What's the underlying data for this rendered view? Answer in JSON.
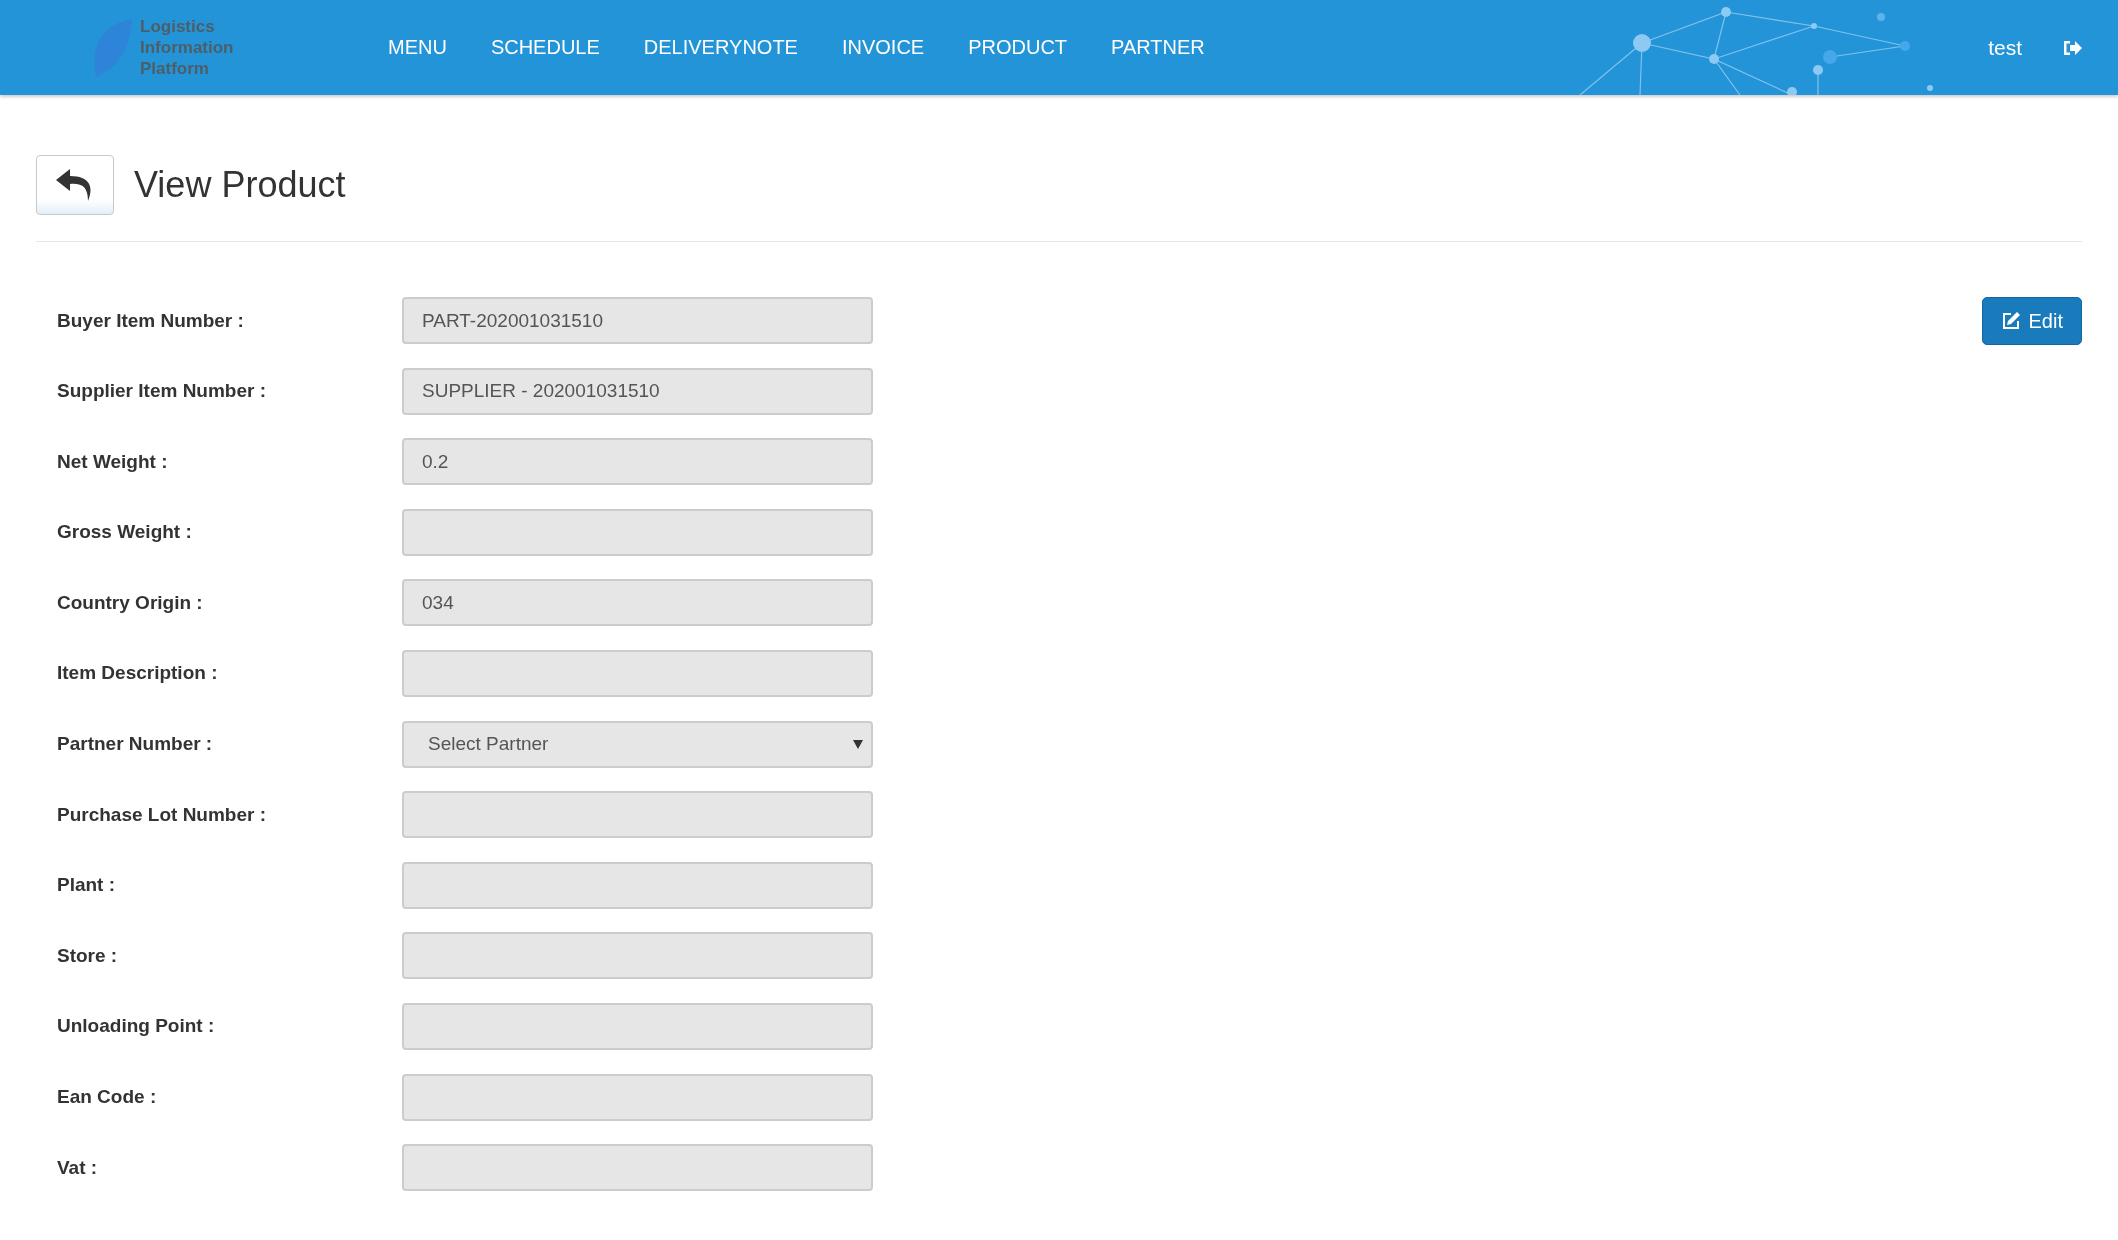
{
  "header": {
    "logo_lines": [
      "Logistics",
      "Information",
      "Platform"
    ],
    "nav": [
      {
        "label": "MENU"
      },
      {
        "label": "SCHEDULE"
      },
      {
        "label": "DELIVERYNOTE"
      },
      {
        "label": "INVOICE"
      },
      {
        "label": "PRODUCT"
      },
      {
        "label": "PARTNER"
      }
    ],
    "user": "test"
  },
  "page": {
    "title": "View Product",
    "edit_button": "Edit"
  },
  "fields": [
    {
      "label": "Buyer Item Number :",
      "kind": "text",
      "value": "PART-202001031510",
      "disabled": true
    },
    {
      "label": "Supplier Item Number :",
      "kind": "text",
      "value": "SUPPLIER - 202001031510",
      "disabled": true
    },
    {
      "label": "Net Weight :",
      "kind": "text",
      "value": "0.2",
      "disabled": true
    },
    {
      "label": "Gross Weight :",
      "kind": "text",
      "disabled": true
    },
    {
      "label": "Country Origin :",
      "kind": "text",
      "value": "034",
      "disabled": true
    },
    {
      "label": "Item Description :",
      "kind": "text",
      "disabled": true
    },
    {
      "label": "Partner Number :",
      "kind": "select",
      "value": "Select Partner",
      "disabled": true
    },
    {
      "label": "Purchase Lot Number :",
      "kind": "text",
      "disabled": true
    },
    {
      "label": "Plant :",
      "kind": "text",
      "disabled": true
    },
    {
      "label": "Store :",
      "kind": "text",
      "disabled": true
    },
    {
      "label": "Unloading Point :",
      "kind": "text",
      "disabled": true
    },
    {
      "label": "Ean Code :",
      "kind": "text",
      "disabled": true
    },
    {
      "label": "Vat :",
      "kind": "text",
      "disabled": true
    }
  ]
}
